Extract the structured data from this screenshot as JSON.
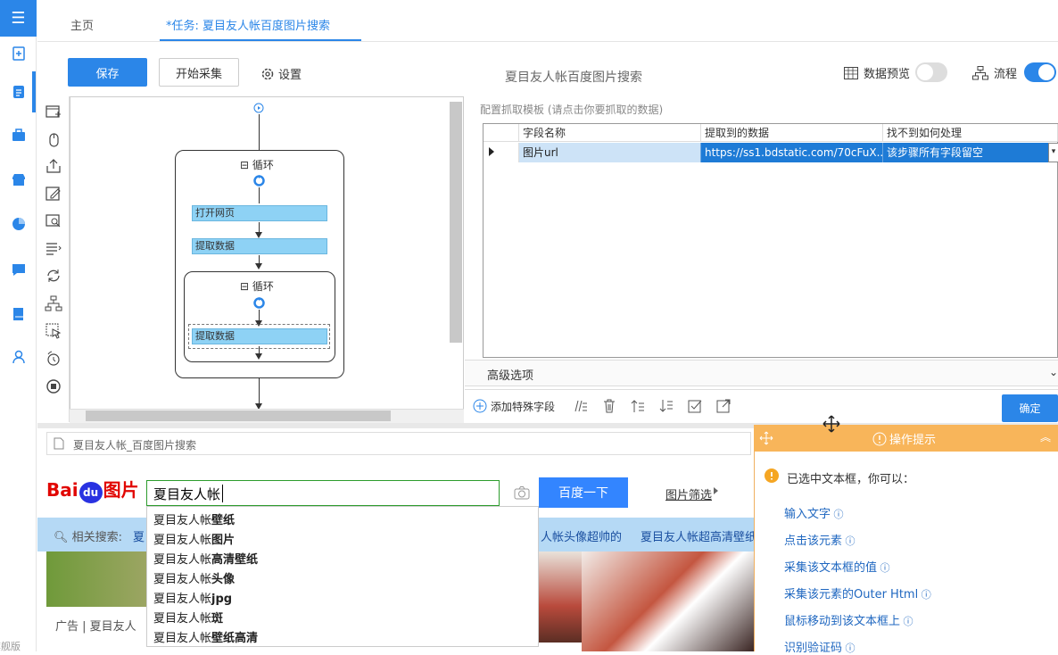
{
  "tabs": {
    "home": "主页",
    "task": "*任务: 夏目友人帐百度图片搜索"
  },
  "toolbar": {
    "save": "保存",
    "start": "开始采集",
    "settings": "设置",
    "title": "夏目友人帐百度图片搜索",
    "preview": "数据预览",
    "flow": "流程",
    "preview_on": false,
    "flow_on": true
  },
  "edition": "旗舰版",
  "flow": {
    "loop1": "循环",
    "open_page": "打开网页",
    "extract1": "提取数据",
    "loop2": "循环",
    "extract2": "提取数据"
  },
  "right_panel": {
    "title": "配置抓取模板 (请点击你要抓取的数据)",
    "columns": [
      "字段名称",
      "提取到的数据",
      "找不到如何处理"
    ],
    "row": {
      "field": "图片url",
      "data": "https://ss1.bdstatic.com/70cFuX...",
      "handling": "该步骤所有字段留空"
    },
    "advanced": "高级选项",
    "add_field": "添加特殊字段",
    "ok": "确定"
  },
  "browser": {
    "address": "夏目友人帐_百度图片搜索",
    "logo": {
      "bai": "Bai",
      "du": "du",
      "img": "图片"
    },
    "search_value": "夏目友人帐",
    "search_button": "百度一下",
    "filter": "图片筛选",
    "related_label": "相关搜索:",
    "related": [
      "夏",
      "人帐头像超帅的",
      "夏目友人帐超高清壁纸"
    ],
    "suggestions": [
      {
        "prefix": "夏目友人帐",
        "bold": "壁纸"
      },
      {
        "prefix": "夏目友人帐",
        "bold": "图片"
      },
      {
        "prefix": "夏目友人帐",
        "bold": "高清壁纸"
      },
      {
        "prefix": "夏目友人帐",
        "bold": "头像"
      },
      {
        "prefix": "夏目友人帐",
        "bold": "jpg"
      },
      {
        "prefix": "夏目友人帐",
        "bold": "斑"
      },
      {
        "prefix": "夏目友人帐",
        "bold": "壁纸高清"
      }
    ],
    "ad_text": "广告 | 夏目友人"
  },
  "tip": {
    "title": "操作提示",
    "message": "已选中文本框，你可以：",
    "actions": [
      "输入文字",
      "点击该元素",
      "采集该文本框的值",
      "采集该元素的Outer Html",
      "鼠标移动到该文本框上",
      "识别验证码"
    ]
  },
  "colors": {
    "accent": "#2b86e8",
    "tip": "#f8b55a",
    "step": "#8ed2f5",
    "grid_select": "#1e7bd6"
  }
}
